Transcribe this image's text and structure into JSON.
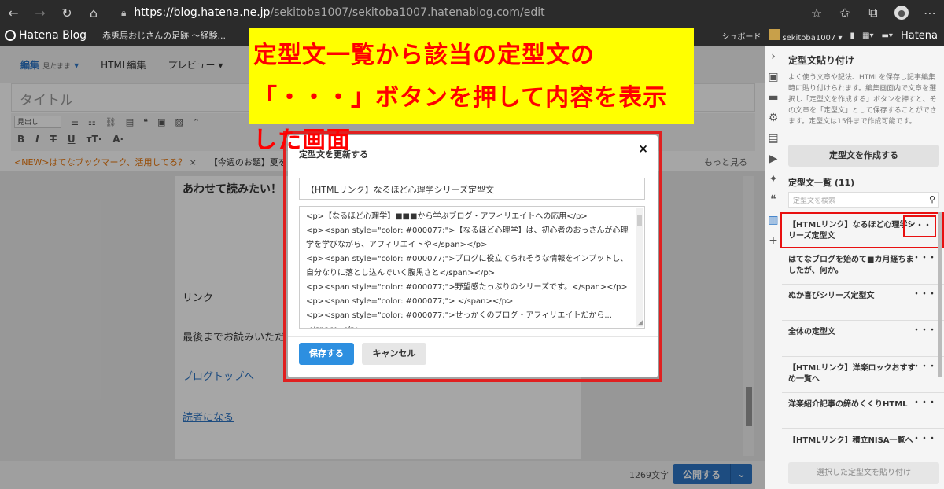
{
  "browser": {
    "url_host": "https://blog.hatena.ne.jp",
    "url_path": "/sekitoba1007/sekitoba1007.hatenablog.com/edit"
  },
  "hatena_bar": {
    "logo": "Hatena Blog",
    "blog_name": "赤兎馬おじさんの足跡 〜経験...",
    "dashboard": "シュボード",
    "user": "sekitoba1007",
    "brand": "Hatena"
  },
  "annotation": {
    "line1": "定型文一覧から該当の定型文の",
    "line2": "「・・・」ボタンを押して内容を表示した画面"
  },
  "editor": {
    "tab_edit": "編集",
    "tab_edit_mode": "見たまま",
    "tab_html": "HTML編集",
    "tab_preview": "プレビュー",
    "title_placeholder": "タイトル",
    "heading_select": "見出し",
    "news_new": "<NEW>はてなブックマーク、活用してる？",
    "news_theme": "【今週のお題】夏を",
    "news_more": "もっと見る",
    "body_heading": "あわせて読みたい！",
    "body_link_label": "リンク",
    "body_closing": "最後までお読みいただ",
    "body_top_link": "ブログトップへ",
    "body_reader_link": "読者になる",
    "char_count": "1269文字",
    "publish": "公開する"
  },
  "sidebar": {
    "title": "定型文貼り付け",
    "description": "よく使う文章や記法、HTMLを保存し記事編集時に貼り付けられます。編集画面内で文章を選択し「定型文を作成する」ボタンを押すと、その文章を「定型文」として保存することができます。定型文は15件まで作成可能です。",
    "create_button": "定型文を作成する",
    "list_title": "定型文一覧 (11)",
    "search_placeholder": "定型文を検索",
    "items": [
      {
        "label": "【HTMLリンク】なるほど心理学シリーズ定型文"
      },
      {
        "label": "はてなブログを始めて■カ月経ちましたが、何か。"
      },
      {
        "label": "ぬか喜びシリーズ定型文"
      },
      {
        "label": "全体の定型文"
      },
      {
        "label": "【HTMLリンク】洋楽ロックおすすめ一覧へ"
      },
      {
        "label": "洋楽紹介記事の締めくくりHTML"
      },
      {
        "label": "【HTMLリンク】積立NISA一覧へ"
      }
    ],
    "dots": "・・・",
    "paste_button": "選択した定型文を貼り付け"
  },
  "modal": {
    "title": "定型文を更新する",
    "close": "×",
    "name_value": "【HTMLリンク】なるほど心理学シリーズ定型文",
    "body_lines": [
      "<p>【なるほど心理学】■■■から学ぶブログ・アフィリエイトへの応用</p>",
      "<p><span style=\"color: #000077;\">【なるほど心理学】は、初心者のおっさんが心理学を学びながら、アフィリエイトや</span></p>",
      "<p><span style=\"color: #000077;\">ブログに役立てられそうな情報をインプットし、自分なりに落とし込んでいく腹黒さと</span></p>",
      "<p><span style=\"color: #000077;\">野望感たっぷりのシリーズです。</span></p>",
      "<p><span style=\"color: #000077;\"> </span></p>",
      "<p><span style=\"color: #000077;\">せっかくのブログ・アフィリエイトだから...</span></p>"
    ],
    "save": "保存する",
    "cancel": "キャンセル"
  },
  "colors": {
    "accent": "#2d75c5",
    "highlight_frame": "#e02020",
    "annotation_bg": "#ffff00",
    "annotation_text": "#ff0000"
  }
}
